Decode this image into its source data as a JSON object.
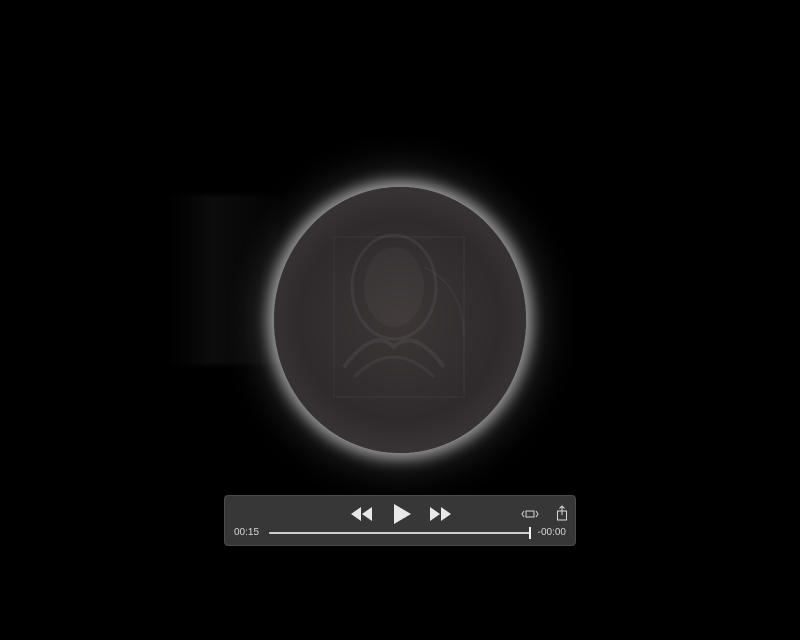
{
  "player": {
    "elapsed": "00:15",
    "remaining": "-00:00",
    "progress": 1.0
  },
  "controls": {
    "rewind_icon": "rewind-icon",
    "play_icon": "play-icon",
    "fast_forward_icon": "fast-forward-icon",
    "resize_icon": "resize-icon",
    "share_icon": "share-icon"
  },
  "colors": {
    "background": "#000000",
    "controller_bg": "#3c3c3c",
    "icon": "#e8e8e8",
    "orb_ring": "#ffffff"
  }
}
